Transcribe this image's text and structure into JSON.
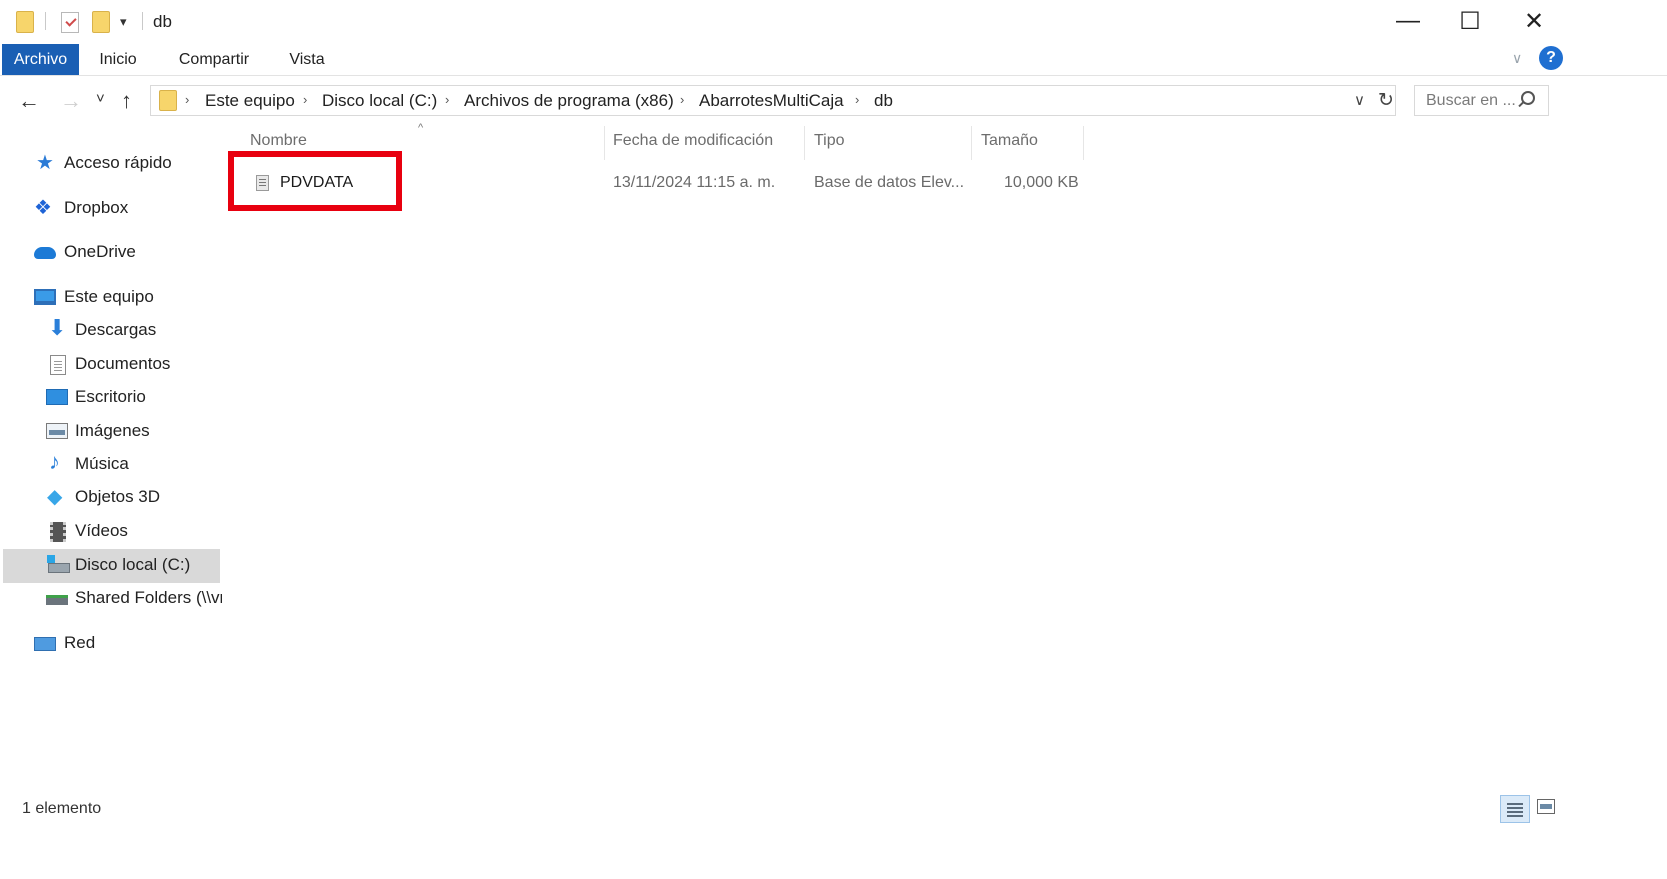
{
  "window": {
    "title": "db",
    "minimize": "—",
    "maximize": "☐",
    "close": "✕"
  },
  "quick_access": {
    "dropdown": "▾"
  },
  "ribbon": {
    "tabs": [
      {
        "label": "Archivo",
        "active": true
      },
      {
        "label": "Inicio",
        "active": false
      },
      {
        "label": "Compartir",
        "active": false
      },
      {
        "label": "Vista",
        "active": false
      }
    ],
    "expand": "∨",
    "help": "?"
  },
  "nav": {
    "back": "←",
    "forward": "→",
    "recent": "˅",
    "up": "↑",
    "breadcrumb": [
      "Este equipo",
      "Disco local (C:)",
      "Archivos de programa (x86)",
      "AbarrotesMultiCaja",
      "db"
    ],
    "separator": "›",
    "dropdown": "∨",
    "refresh": "↻",
    "search_placeholder": "Buscar en ..."
  },
  "sidebar": {
    "items": [
      {
        "label": "Acceso rápido",
        "icon": "star-icon"
      },
      {
        "label": "Dropbox",
        "icon": "dropbox-icon"
      },
      {
        "label": "OneDrive",
        "icon": "cloud-icon"
      },
      {
        "label": "Este equipo",
        "icon": "computer-icon"
      },
      {
        "label": "Descargas",
        "icon": "download-icon"
      },
      {
        "label": "Documentos",
        "icon": "document-icon"
      },
      {
        "label": "Escritorio",
        "icon": "desktop-icon"
      },
      {
        "label": "Imágenes",
        "icon": "pictures-icon"
      },
      {
        "label": "Música",
        "icon": "music-icon"
      },
      {
        "label": "Objetos 3D",
        "icon": "cube-icon"
      },
      {
        "label": "Vídeos",
        "icon": "video-icon"
      },
      {
        "label": "Disco local (C:)",
        "icon": "drive-icon",
        "selected": true
      },
      {
        "label": "Shared Folders (\\\\vr",
        "icon": "network-drive-icon"
      },
      {
        "label": "Red",
        "icon": "network-icon"
      }
    ]
  },
  "details": {
    "columns": [
      "Nombre",
      "Fecha de modificación",
      "Tipo",
      "Tamaño"
    ],
    "sort_indicator": "^",
    "rows": [
      {
        "name": "PDVDATA",
        "modified": "13/11/2024 11:15 a. m.",
        "type": "Base de datos Elev...",
        "size": "10,000 KB",
        "icon": "database-file-icon"
      }
    ],
    "highlight_color": "#e8000f"
  },
  "status": {
    "count": "1 elemento"
  },
  "colors": {
    "accent": "#1a5fb4",
    "folder": "#f7d56b",
    "help": "#1f6fd1"
  }
}
